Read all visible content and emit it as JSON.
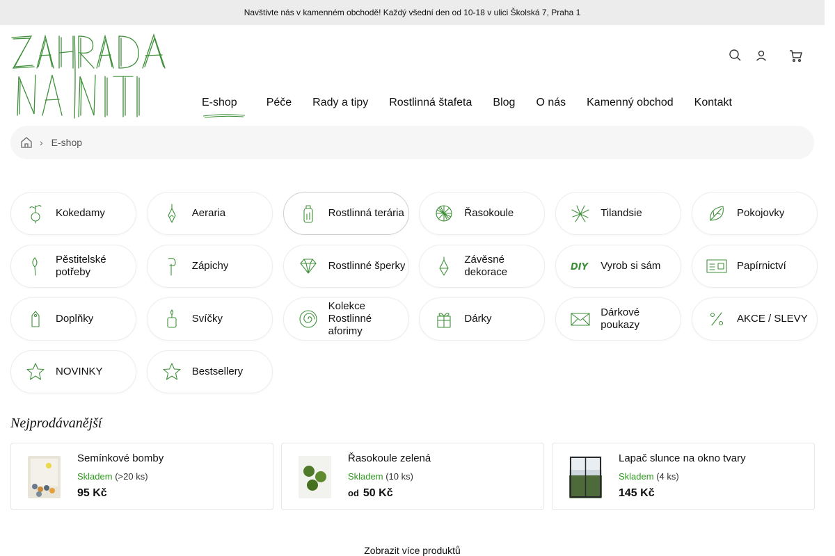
{
  "topbar": {
    "message": " Navštivte nás v kamenném obchodě! Každý všední den od 10-18 v ulici Školská 7, Praha 1",
    "close": ""
  },
  "logo": {
    "line1": "ZAHRADA",
    "line2": "NA NITI"
  },
  "nav": {
    "items": [
      "E-shop",
      "Péče",
      "Rady a tipy",
      "Rostlinná štafeta",
      "Blog",
      "O nás",
      "Kamenný obchod",
      "Kontakt"
    ],
    "caret": ""
  },
  "header_icons": [
    "search-icon",
    "user-icon",
    "cart-icon"
  ],
  "breadcrumb": {
    "sep": "›",
    "current": "E-shop"
  },
  "categories": [
    {
      "label": "Kokedamy",
      "icon": "kokedama-icon"
    },
    {
      "label": "Aeraria",
      "icon": "aerarium-icon"
    },
    {
      "label": "Rostlinná terária",
      "icon": "terrarium-icon"
    },
    {
      "label": "Řasokoule",
      "icon": "moss-ball-icon"
    },
    {
      "label": "Tilandsie",
      "icon": "tillandsia-icon"
    },
    {
      "label": "Pokojovky",
      "icon": "leaf-icon"
    },
    {
      "label": "Pěstitelské potřeby",
      "icon": "trowel-icon"
    },
    {
      "label": "Zápichy",
      "icon": "plant-stick-icon"
    },
    {
      "label": "Rostlinné šperky",
      "icon": "diamond-icon"
    },
    {
      "label": "Závěsné dekorace",
      "icon": "hanging-decor-icon"
    },
    {
      "label": "Vyrob si sám",
      "icon": "diy-icon"
    },
    {
      "label": "Papírnictví",
      "icon": "stationery-icon"
    },
    {
      "label": "Doplňky",
      "icon": "tag-icon"
    },
    {
      "label": "Svíčky",
      "icon": "candle-icon"
    },
    {
      "label": "Kolekce Rostlinné aforimy",
      "icon": "spiral-icon"
    },
    {
      "label": "Dárky",
      "icon": "gift-icon"
    },
    {
      "label": "Dárkové poukazy",
      "icon": "envelope-icon"
    },
    {
      "label": "AKCE / SLEVY",
      "icon": "percent-icon"
    },
    {
      "label": "NOVINKY",
      "icon": "star-icon"
    },
    {
      "label": "Bestsellery",
      "icon": "star-icon"
    }
  ],
  "bestsellers": {
    "title": "Nejprodávanější",
    "products": [
      {
        "name": "Semínkové bomby",
        "stock_label": "Skladem",
        "stock_qty": "(>20 ks)",
        "price_prefix": "",
        "price": "95 Kč"
      },
      {
        "name": "Řasokoule zelená",
        "stock_label": "Skladem",
        "stock_qty": "(10 ks)",
        "price_prefix": "od",
        "price": "50 Kč"
      },
      {
        "name": "Lapač slunce na okno tvary",
        "stock_label": "Skladem",
        "stock_qty": "(4 ks)",
        "price_prefix": "",
        "price": "145 Kč"
      }
    ],
    "more_label": "Zobrazit více produktů "
  },
  "colors": {
    "brand_green": "#2e7d32",
    "stock_green": "#2e9a1f",
    "topbar_bg": "#ececec"
  }
}
